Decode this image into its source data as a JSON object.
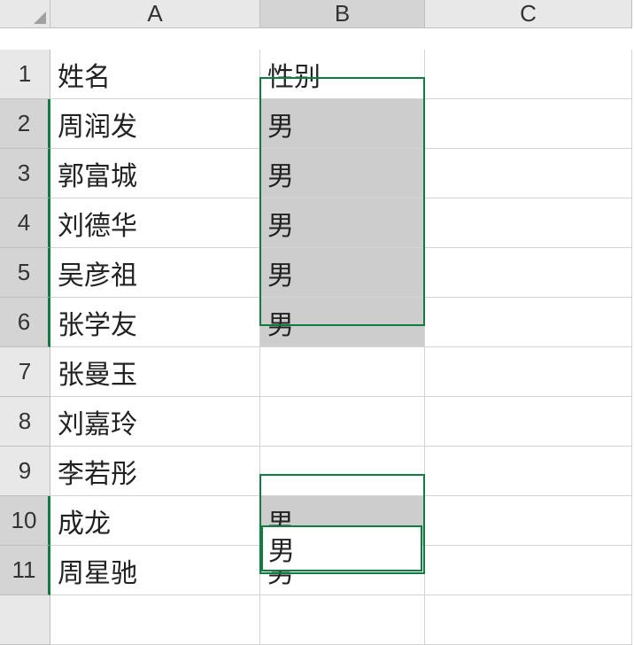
{
  "columns": [
    "A",
    "B",
    "C"
  ],
  "rowCount": 12,
  "headers": {
    "A": "姓名",
    "B": "性别"
  },
  "rows": [
    {
      "A": "周润发",
      "B": "男",
      "selected": true
    },
    {
      "A": "郭富城",
      "B": "男",
      "selected": true
    },
    {
      "A": "刘德华",
      "B": "男",
      "selected": true
    },
    {
      "A": "吴彦祖",
      "B": "男",
      "selected": true
    },
    {
      "A": "张学友",
      "B": "男",
      "selected": true
    },
    {
      "A": "张曼玉",
      "B": "",
      "selected": false
    },
    {
      "A": "刘嘉玲",
      "B": "",
      "selected": false
    },
    {
      "A": "李若彤",
      "B": "",
      "selected": false
    },
    {
      "A": "成龙",
      "B": "男",
      "selected": true
    },
    {
      "A": "周星驰",
      "B": "男",
      "selected": true,
      "active": true
    }
  ],
  "activeColumn": "B",
  "activeRows": [
    2,
    3,
    4,
    5,
    6,
    10,
    11
  ]
}
